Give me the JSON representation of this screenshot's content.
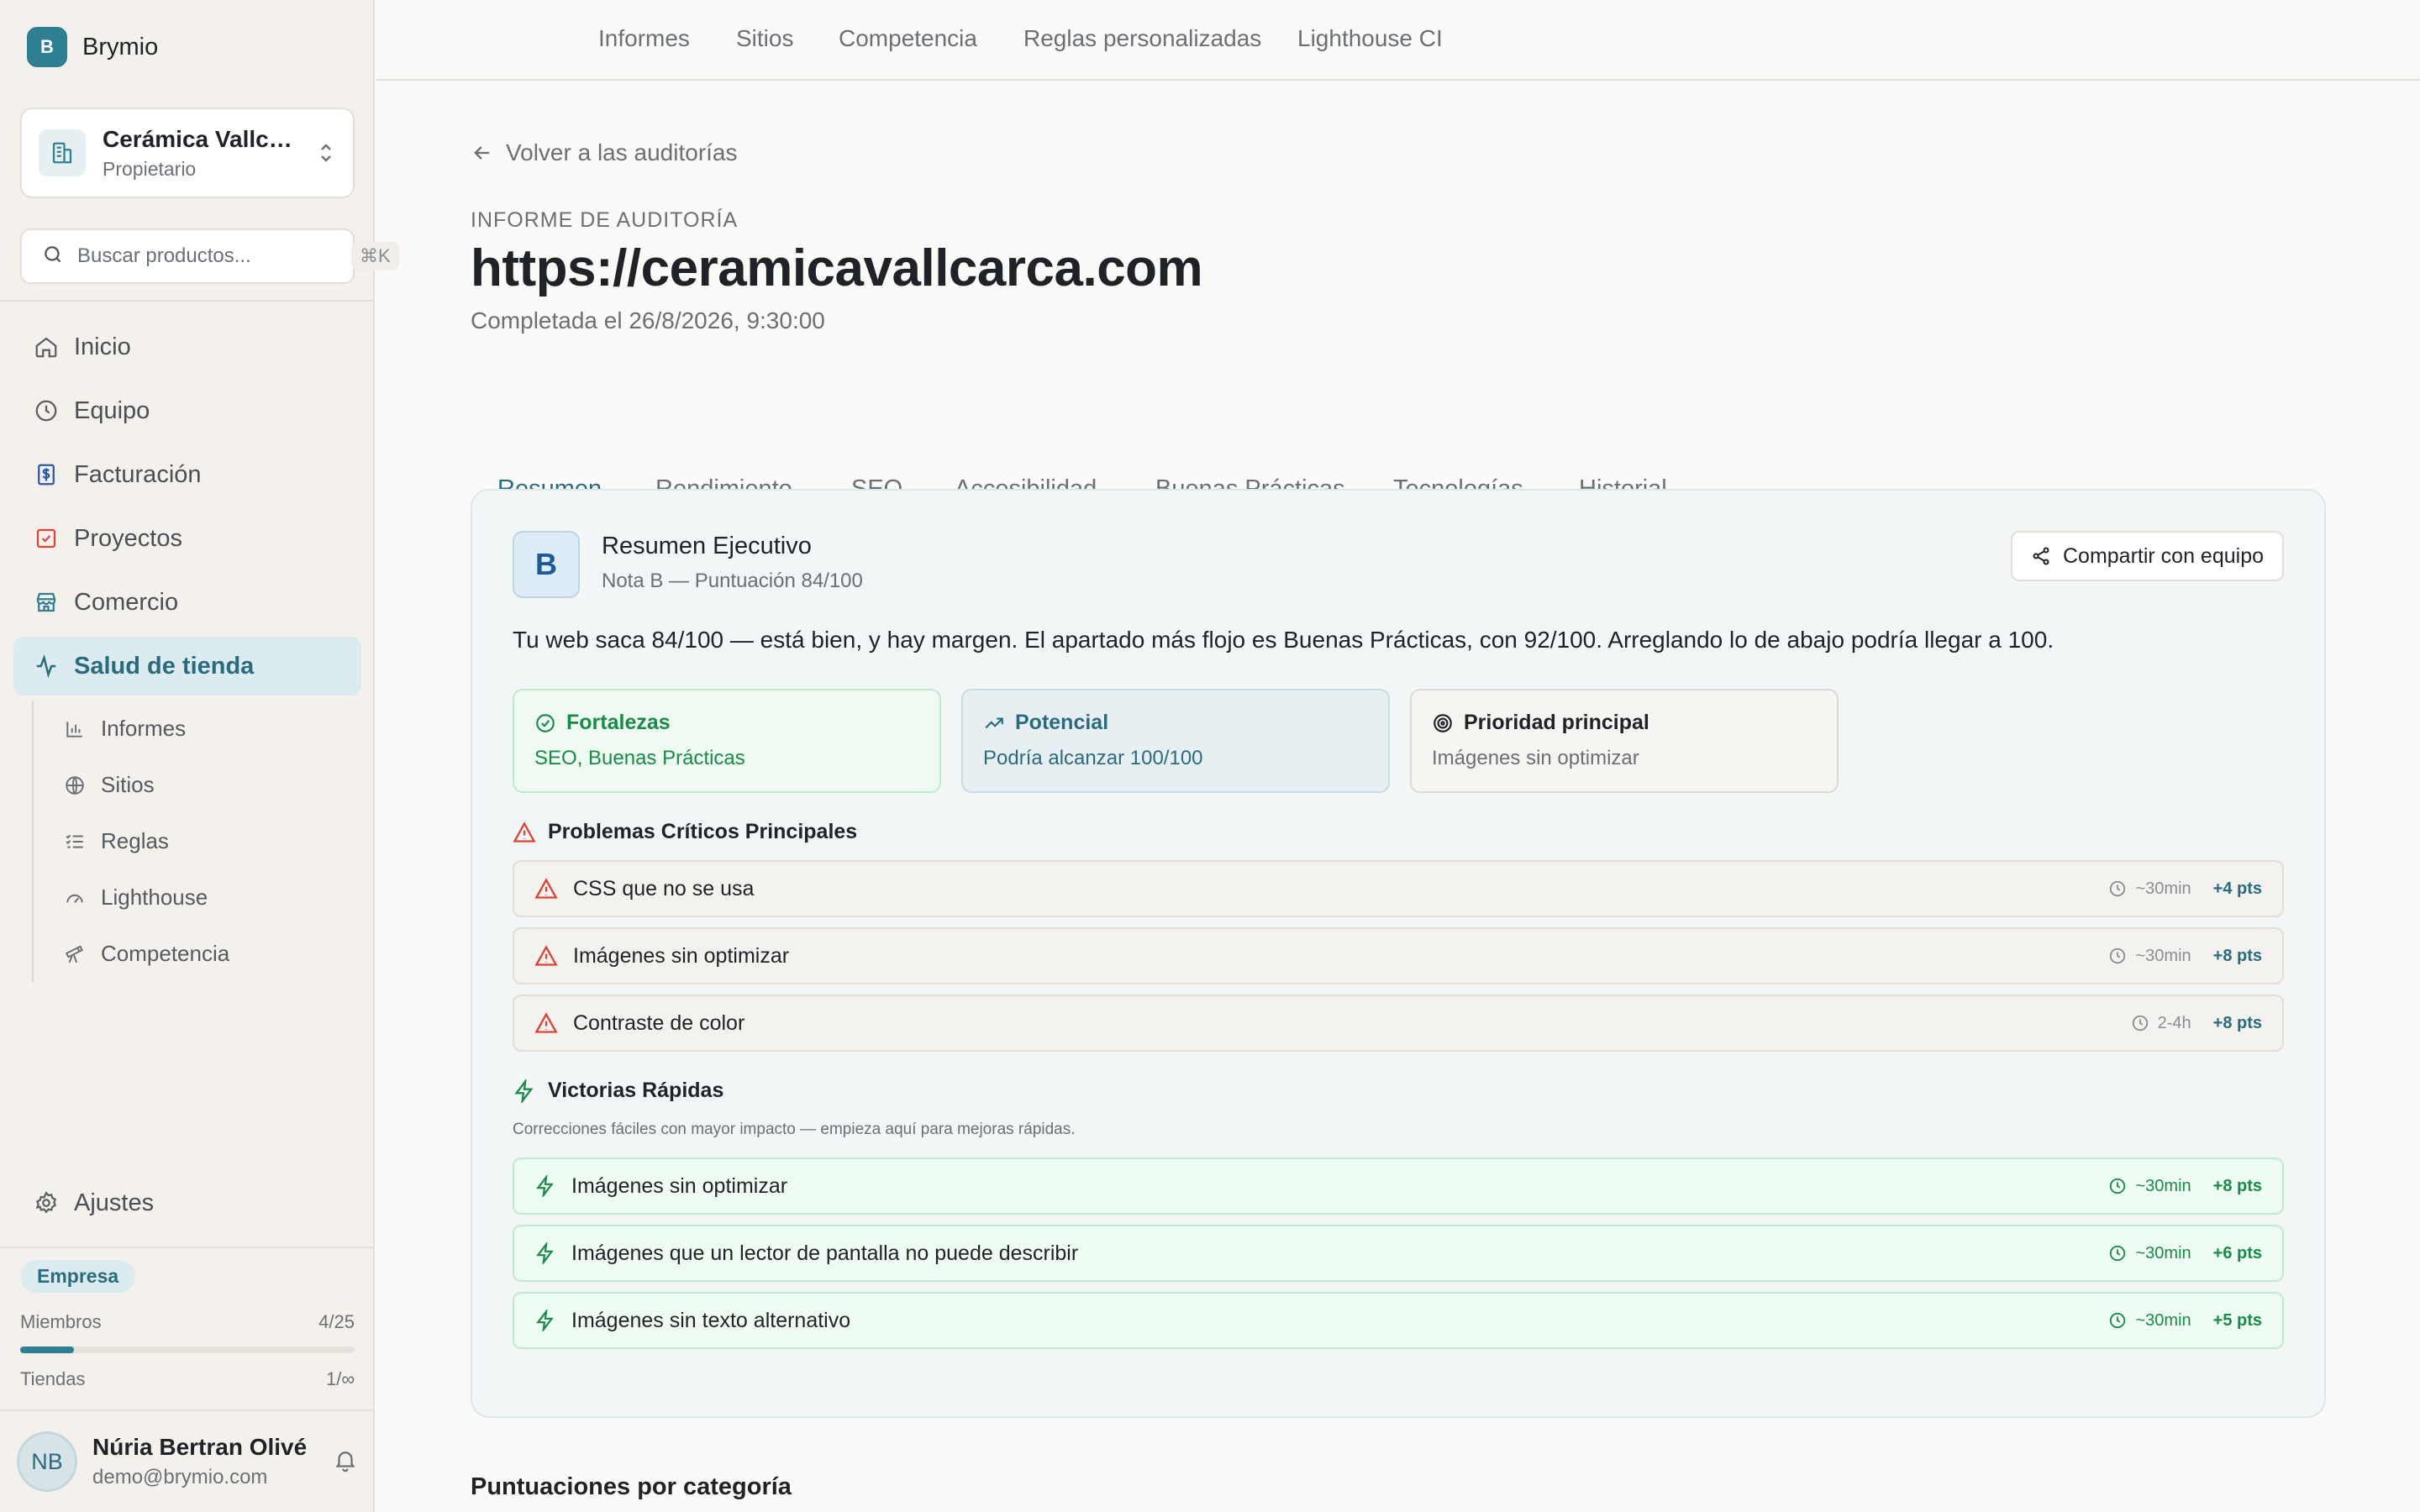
{
  "brand": {
    "logo_letter": "B",
    "name": "Brymio"
  },
  "org": {
    "name": "Cerámica Vallcarca",
    "role": "Propietario"
  },
  "search": {
    "placeholder": "Buscar productos...",
    "shortcut": "⌘K"
  },
  "nav": [
    {
      "label": "Inicio",
      "icon": "home-icon"
    },
    {
      "label": "Equipo",
      "icon": "clock-icon"
    },
    {
      "label": "Facturación",
      "icon": "billing-icon"
    },
    {
      "label": "Proyectos",
      "icon": "checkbox-icon"
    },
    {
      "label": "Comercio",
      "icon": "store-icon"
    },
    {
      "label": "Salud de tienda",
      "icon": "pulse-icon",
      "active": true
    }
  ],
  "subnav": [
    {
      "label": "Informes",
      "icon": "bar-chart-icon"
    },
    {
      "label": "Sitios",
      "icon": "globe-icon"
    },
    {
      "label": "Reglas",
      "icon": "list-check-icon"
    },
    {
      "label": "Lighthouse",
      "icon": "gauge-icon"
    },
    {
      "label": "Competencia",
      "icon": "telescope-icon"
    }
  ],
  "settings": {
    "label": "Ajustes"
  },
  "plan": {
    "badge": "Empresa",
    "members_label": "Miembros",
    "members_value": "4/25",
    "members_fraction": 0.16,
    "stores_label": "Tiendas",
    "stores_value": "1/∞"
  },
  "user": {
    "initials": "NB",
    "name": "Núria Bertran Olivé",
    "email": "demo@brymio.com"
  },
  "topnav": [
    "Informes",
    "Sitios",
    "Competencia",
    "Reglas personalizadas",
    "Lighthouse CI"
  ],
  "page": {
    "back_label": "Volver a las auditorías",
    "eyebrow": "INFORME DE AUDITORÍA",
    "title": "https://ceramicavallcarca.com",
    "completed": "Completada el 26/8/2026, 9:30:00"
  },
  "tabs": [
    "Resumen",
    "Rendimiento",
    "SEO",
    "Accesibilidad",
    "Buenas Prácticas",
    "Tecnologías",
    "Historial"
  ],
  "active_tab": "Resumen",
  "executive": {
    "grade": "B",
    "title": "Resumen Ejecutivo",
    "subtitle": "Nota B — Puntuación 84/100",
    "share_label": "Compartir con equipo",
    "summary": "Tu web saca 84/100 — está bien, y hay margen. El apartado más flojo es Buenas Prácticas, con 92/100. Arreglando lo de abajo podría llegar a 100.",
    "strengths": {
      "title": "Fortalezas",
      "text": "SEO, Buenas Prácticas"
    },
    "potential": {
      "title": "Potencial",
      "text": "Podría alcanzar 100/100"
    },
    "priority": {
      "title": "Prioridad principal",
      "text": "Imágenes sin optimizar"
    }
  },
  "critical": {
    "title": "Problemas Críticos Principales",
    "items": [
      {
        "label": "CSS que no se usa",
        "time": "~30min",
        "pts": "+4 pts"
      },
      {
        "label": "Imágenes sin optimizar",
        "time": "~30min",
        "pts": "+8 pts"
      },
      {
        "label": "Contraste de color",
        "time": "2-4h",
        "pts": "+8 pts"
      }
    ]
  },
  "quick_wins": {
    "title": "Victorias Rápidas",
    "note": "Correcciones fáciles con mayor impacto — empieza aquí para mejoras rápidas.",
    "items": [
      {
        "label": "Imágenes sin optimizar",
        "time": "~30min",
        "pts": "+8 pts"
      },
      {
        "label": "Imágenes que un lector de pantalla no puede describir",
        "time": "~30min",
        "pts": "+6 pts"
      },
      {
        "label": "Imágenes sin texto alternativo",
        "time": "~30min",
        "pts": "+5 pts"
      }
    ]
  },
  "categories_title": "Puntuaciones por categoría",
  "colors": {
    "accent": "#2f7f92",
    "success": "#1a8a48",
    "danger": "#d9453a"
  }
}
